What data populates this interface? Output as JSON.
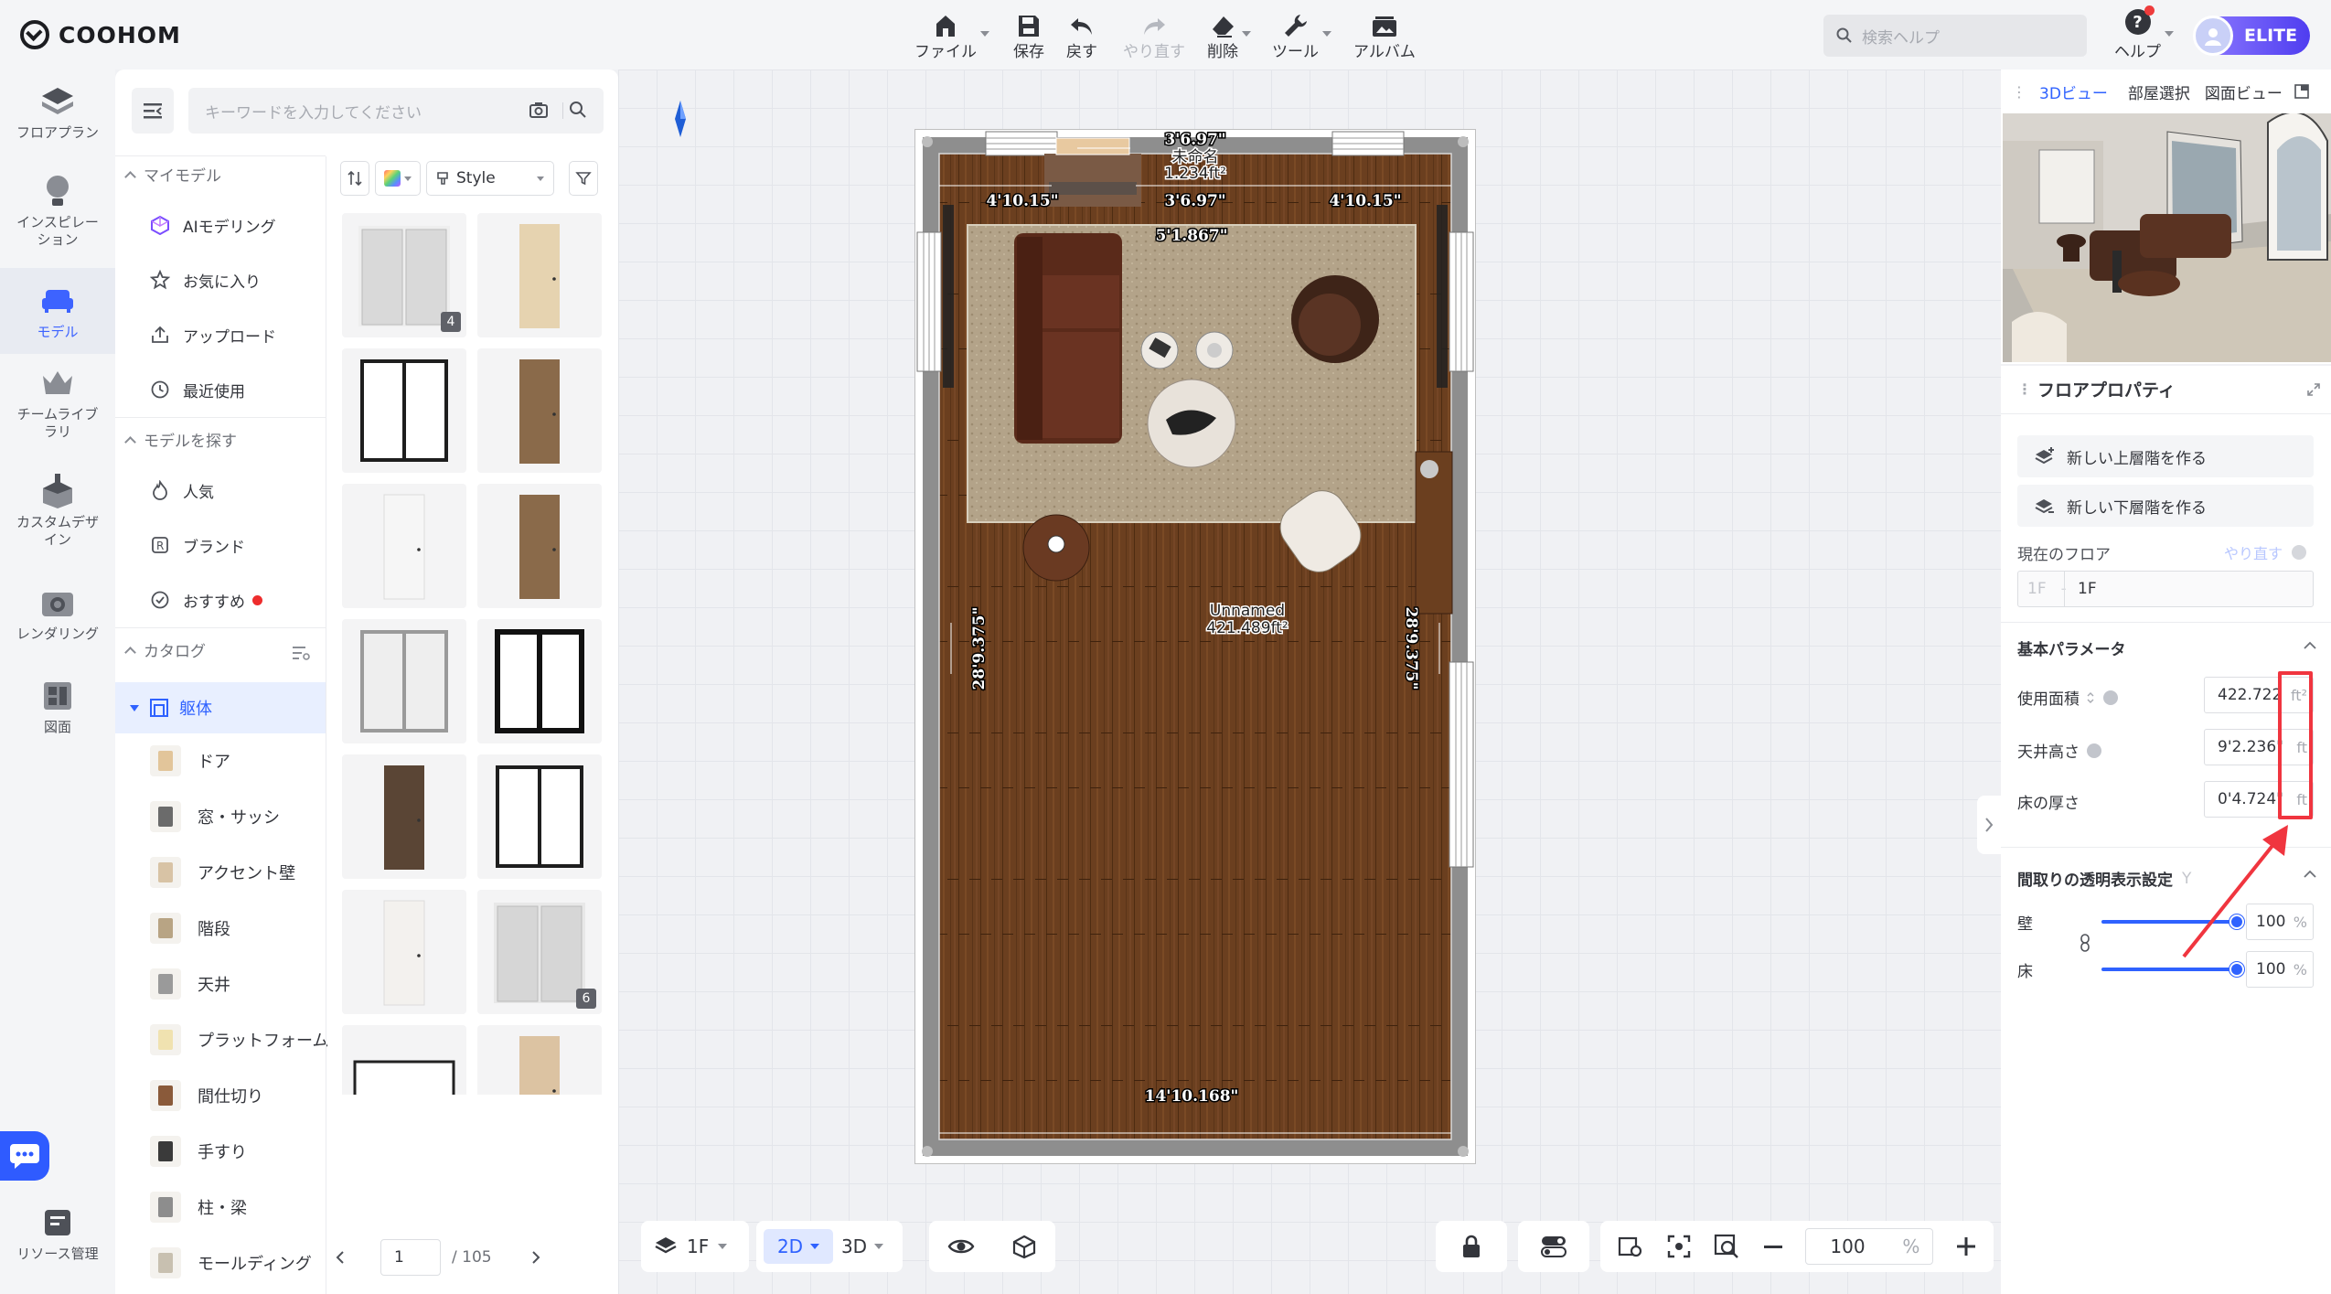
{
  "app": {
    "logo": "COOHOM"
  },
  "toolbar": {
    "items": [
      {
        "label": "ファイル",
        "icon": "file-icon",
        "dropdown": true,
        "disabled": false
      },
      {
        "label": "保存",
        "icon": "save-icon",
        "dropdown": false,
        "disabled": false
      },
      {
        "label": "戻す",
        "icon": "undo-icon",
        "dropdown": false,
        "disabled": false
      },
      {
        "label": "やり直す",
        "icon": "redo-icon",
        "dropdown": false,
        "disabled": true
      },
      {
        "label": "削除",
        "icon": "eraser-icon",
        "dropdown": true,
        "disabled": false
      },
      {
        "label": "ツール",
        "icon": "wrench-icon",
        "dropdown": true,
        "disabled": false
      },
      {
        "label": "アルバム",
        "icon": "album-icon",
        "dropdown": false,
        "disabled": false
      }
    ],
    "search_placeholder": "検索ヘルプ",
    "help_label": "ヘルプ",
    "badge_label": "ELITE"
  },
  "leftnav": {
    "items": [
      {
        "label": "フロアプラン",
        "icon": "floorplan-icon"
      },
      {
        "label": "インスピレーション",
        "icon": "lightbulb-icon"
      },
      {
        "label": "モデル",
        "icon": "sofa-icon",
        "active": true
      },
      {
        "label": "チームライブラリ",
        "icon": "crown-icon"
      },
      {
        "label": "カスタムデザイン",
        "icon": "custom-design-icon"
      },
      {
        "label": "レンダリング",
        "icon": "camera-icon"
      },
      {
        "label": "図面",
        "icon": "drawing-icon"
      }
    ],
    "resource_label": "リソース管理"
  },
  "model_panel": {
    "search_placeholder": "キーワードを入力してください",
    "sections": {
      "my_models": "マイモデル",
      "find_models": "モデルを探す",
      "catalog": "カタログ"
    },
    "my_models": [
      "AIモデリング",
      "お気に入り",
      "アップロード",
      "最近使用"
    ],
    "find_models": [
      "人気",
      "ブランド",
      "おすすめ"
    ],
    "catalog_selected": "躯体",
    "catalog_items": [
      "ドア",
      "窓・サッシ",
      "アクセント壁",
      "階段",
      "天井",
      "プラットフォーム",
      "間仕切り",
      "手すり",
      "柱・梁",
      "モールディング"
    ],
    "filter_style": "Style",
    "tile_badges": {
      "first": "4",
      "tenth": "6"
    },
    "pager": {
      "current": "1",
      "total": "/ 105"
    }
  },
  "floorplan": {
    "dims": {
      "top_outer": "3'6.97\"",
      "top_inner": "3'6.97\"",
      "left_top": "4'10.15\"",
      "right_top": "4'10.15\"",
      "rug_top": "5'1.867\"",
      "left_side": "28'9.375\"",
      "right_side": "28'9.375\"",
      "bottom": "14'10.168\""
    },
    "fireplace_name": "未命名",
    "fireplace_area": "1.234ft²",
    "room_name": "Unnamed",
    "room_area": "421.489ft²"
  },
  "bottom_toolbar": {
    "floor": "1F",
    "view_2d": "2D",
    "view_3d": "3D",
    "zoom": "100",
    "zoom_unit": "%"
  },
  "right_panel": {
    "tabs": [
      "3Dビュー",
      "部屋選択",
      "図面ビュー"
    ],
    "active_tab": "3Dビュー",
    "properties_title": "フロアプロパティ",
    "create_upper": "新しい上層階を作る",
    "create_lower": "新しい下層階を作る",
    "current_floor_label": "現在のフロア",
    "current_floor_redo": "やり直す",
    "floor_prefix": "1F",
    "floor_value": "1F",
    "basic_params_title": "基本パラメータ",
    "params": [
      {
        "label": "使用面積",
        "value": "422.722",
        "unit": "ft²"
      },
      {
        "label": "天井高さ",
        "value": "9'2.236\"",
        "unit": "ft"
      },
      {
        "label": "床の厚さ",
        "value": "0'4.724\"",
        "unit": "ft"
      }
    ],
    "transparency_title": "間取りの透明表示設定",
    "transparency_hint": "Y",
    "transparency": [
      {
        "label": "壁",
        "value": "100",
        "unit": "%"
      },
      {
        "label": "床",
        "value": "100",
        "unit": "%"
      }
    ]
  },
  "colors": {
    "accent": "#2f62ff",
    "highlight": "#f0353f",
    "floor_wood": "#6b3f1f",
    "wall": "#8e8e8e"
  }
}
